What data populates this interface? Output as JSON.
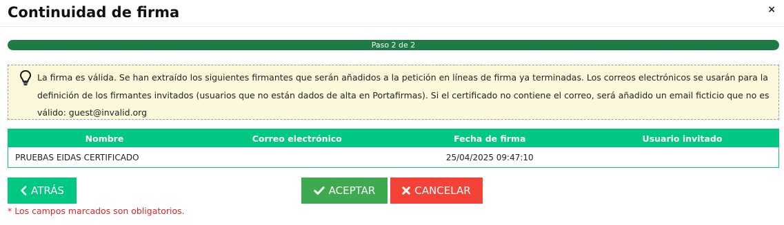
{
  "dialog": {
    "title": "Continuidad de firma",
    "close_label": "×"
  },
  "progress": {
    "label": "Paso 2 de 2",
    "value": 1.0,
    "color": "#1f7a46"
  },
  "info": {
    "icon": "lightbulb-icon",
    "text": "La firma es válida. Se han extraído los siguientes firmantes que serán añadidos a la petición en líneas de firma ya terminadas. Los correos electrónicos se usarán para la definición de los firmantes invitados (usuarios que no están dados de alta en Portafirmas). Si el certificado no contiene el correo, será añadido un email ficticio que no es válido: guest@invalid.org"
  },
  "table": {
    "headers": [
      "Nombre",
      "Correo electrónico",
      "Fecha de firma",
      "Usuario invitado"
    ],
    "rows": [
      [
        "PRUEBAS EIDAS CERTIFICADO",
        "",
        "25/04/2025 09:47:10",
        ""
      ]
    ],
    "header_color": "#00c882"
  },
  "buttons": {
    "back": {
      "label": "ATRÁS",
      "icon": "chevron-left-icon"
    },
    "accept": {
      "label": "ACEPTAR",
      "icon": "check-icon"
    },
    "cancel": {
      "label": "CANCELAR",
      "icon": "close-x-icon"
    }
  },
  "required_note": "* Los campos marcados son obligatorios."
}
